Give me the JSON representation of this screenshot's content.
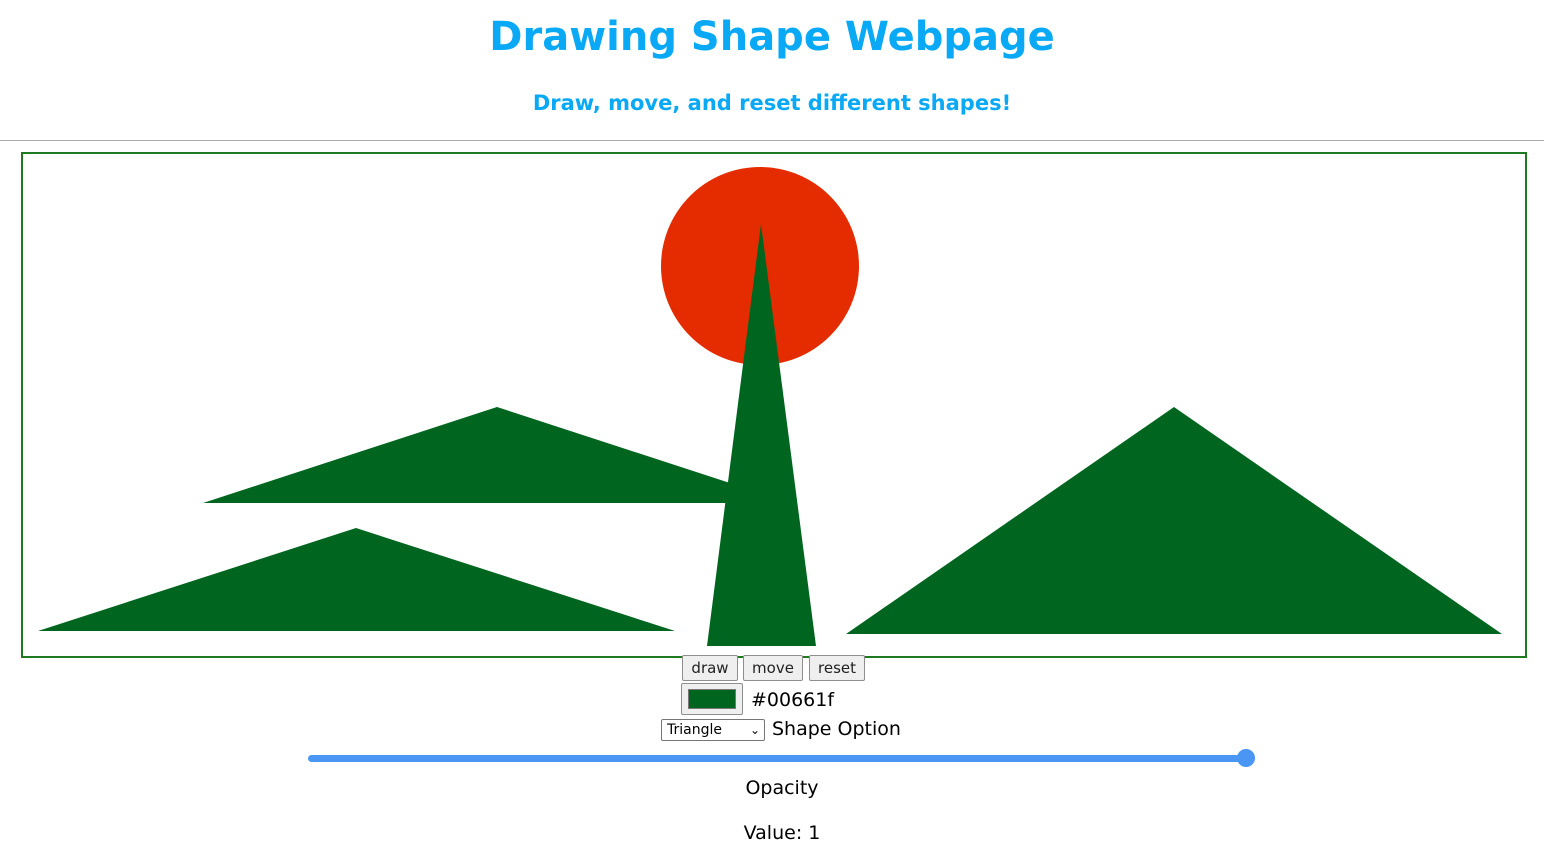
{
  "header": {
    "title": "Drawing Shape Webpage",
    "subtitle": "Draw, move, and reset different shapes!"
  },
  "canvas": {
    "shapes": [
      {
        "type": "circle",
        "color": "#e52c00"
      },
      {
        "type": "triangle",
        "color": "#00661f"
      },
      {
        "type": "triangle",
        "color": "#00661f"
      },
      {
        "type": "triangle",
        "color": "#00661f"
      },
      {
        "type": "triangle",
        "color": "#00661f"
      }
    ]
  },
  "toolbar": {
    "draw_label": "draw",
    "move_label": "move",
    "reset_label": "reset"
  },
  "color": {
    "value": "#00661f"
  },
  "shape_select": {
    "selected": "Triangle",
    "label": "Shape Option"
  },
  "opacity": {
    "level": 1,
    "label": "Opacity",
    "value_text": "Value: 1"
  }
}
